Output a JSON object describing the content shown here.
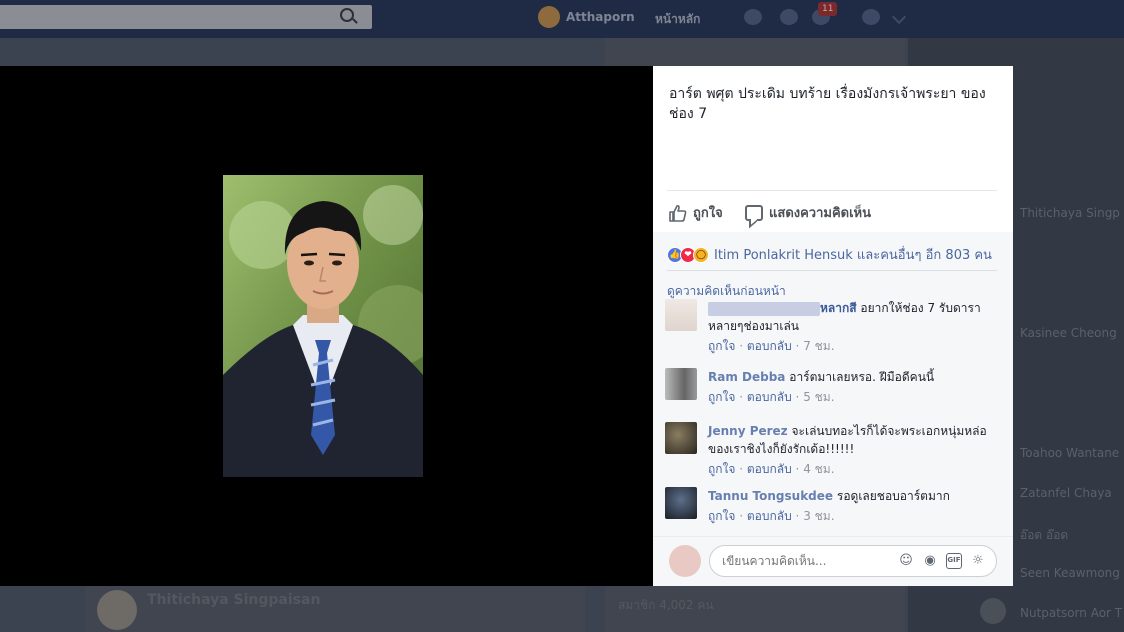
{
  "topbar": {
    "user_name": "Atthaporn",
    "home_label": "หน้าหลัก",
    "notification_count": "11",
    "icons": [
      "search-icon",
      "friends-icon",
      "messenger-icon",
      "notifications-icon",
      "help-icon",
      "chevron-down-icon"
    ]
  },
  "background": {
    "post_author": "Thitichaya Singpaisan",
    "mid_text": "สมาชิก 4,002 คน",
    "contacts": [
      "Thitichaya Singp",
      "Kasinee Cheong",
      "Toahoo Wantane",
      "Zatanfel Chaya",
      "อ๊อด อ๊อด",
      "Seen Keawmong",
      "Nutpatsorn Aor T"
    ]
  },
  "post": {
    "caption": "อาร์ต พศุต ประเดิม บทร้าย เรื่องมังกรเจ้าพระยา ของ ช่อง 7",
    "like_label": "ถูกใจ",
    "comment_label": "แสดงความคิดเห็น",
    "reactions_text": "Itim Ponlakrit Hensuk และคนอื่นๆ อีก 803 คน",
    "reaction_icons": [
      "like-icon",
      "love-icon",
      "wow-icon"
    ],
    "view_previous": "ดูความคิดเห็นก่อนหน้า"
  },
  "comments": [
    {
      "name": "หลากสี",
      "text": "อยากให้ช่อง 7 รับดาราหลายๆช่องมาเล่น",
      "like": "ถูกใจ",
      "reply": "ตอบกลับ",
      "time": "7 ชม."
    },
    {
      "name": "Ram Debba",
      "text": "อาร์ตมาเลยหรอ. ฝีมือดีคนนี้",
      "like": "ถูกใจ",
      "reply": "ตอบกลับ",
      "time": "5 ชม."
    },
    {
      "name": "Jenny Perez",
      "text": "จะเล่นบทอะไรก็ได้จะพระเอกหนุ่มหล่อของเราชิงไงก็ยังรักเด้อ!!!!!!",
      "like": "ถูกใจ",
      "reply": "ตอบกลับ",
      "time": "4 ชม."
    },
    {
      "name": "Tannu Tongsukdee",
      "text": "รอดูเลยชอบอาร์ตมาก",
      "like": "ถูกใจ",
      "reply": "ตอบกลับ",
      "time": "3 ชม."
    }
  ],
  "composer": {
    "placeholder": "เขียนความคิดเห็น...",
    "icons": [
      "emoji-icon",
      "camera-icon",
      "gif-icon",
      "sticker-icon"
    ],
    "gif_label": "GIF"
  },
  "colors": {
    "link": "#4b67a1",
    "name": "#385898",
    "theater": "#000000",
    "overlay_bg": "#3b4250"
  }
}
